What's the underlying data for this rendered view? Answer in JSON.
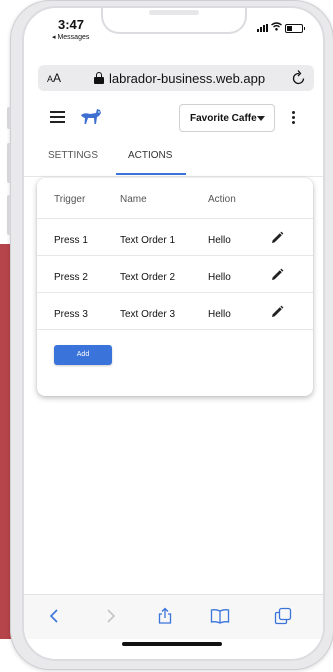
{
  "status": {
    "time": "3:47",
    "back_app": "◂ Messages"
  },
  "browser": {
    "aa_small": "A",
    "aa_large": "A",
    "url": "labrador-business.web.app",
    "reload_icon": "reload-icon"
  },
  "header": {
    "business": "Favorite Caffe",
    "logo_icon": "dog-logo-icon"
  },
  "tabs": [
    {
      "label": "SETTINGS"
    },
    {
      "label": "ACTIONS",
      "active": true
    }
  ],
  "table": {
    "headers": [
      "Trigger",
      "Name",
      "Action"
    ],
    "rows": [
      {
        "trigger": "Press 1",
        "name": "Text Order 1",
        "action": "Hello"
      },
      {
        "trigger": "Press 2",
        "name": "Text Order 2",
        "action": "Hello"
      },
      {
        "trigger": "Press 3",
        "name": "Text Order 3",
        "action": "Hello"
      }
    ],
    "edit_icon": "pencil-icon"
  },
  "add_button": "Add",
  "colors": {
    "accent": "#3a73d9",
    "background_red": "#b5454a"
  },
  "toolbar_icons": [
    "back-icon",
    "forward-icon",
    "share-icon",
    "bookmarks-icon",
    "tabs-icon"
  ]
}
